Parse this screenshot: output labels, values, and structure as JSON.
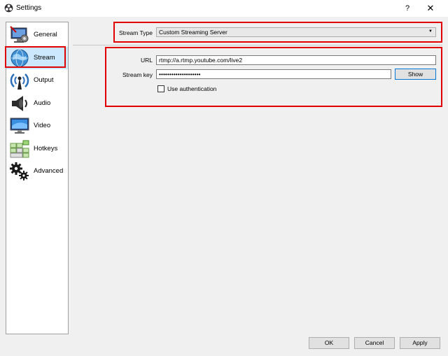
{
  "window": {
    "title": "Settings",
    "help": "?",
    "close": "✕"
  },
  "sidebar": {
    "items": [
      {
        "label": "General",
        "icon": "monitor-gear-icon"
      },
      {
        "label": "Stream",
        "icon": "globe-icon",
        "selected": true
      },
      {
        "label": "Output",
        "icon": "broadcast-icon"
      },
      {
        "label": "Audio",
        "icon": "speaker-icon"
      },
      {
        "label": "Video",
        "icon": "display-icon"
      },
      {
        "label": "Hotkeys",
        "icon": "keyboard-icon"
      },
      {
        "label": "Advanced",
        "icon": "gears-icon"
      }
    ]
  },
  "stream": {
    "type_label": "Stream Type",
    "type_value": "Custom Streaming Server",
    "url_label": "URL",
    "url_value": "rtmp://a.rtmp.youtube.com/live2",
    "key_label": "Stream key",
    "key_value": "••••••••••••••••••••",
    "show_label": "Show",
    "auth_label": "Use authentication",
    "auth_checked": false
  },
  "buttons": {
    "ok": "OK",
    "cancel": "Cancel",
    "apply": "Apply"
  },
  "colors": {
    "highlight": "#e00000",
    "selection": "#cce8ff",
    "focus": "#0078d7"
  }
}
